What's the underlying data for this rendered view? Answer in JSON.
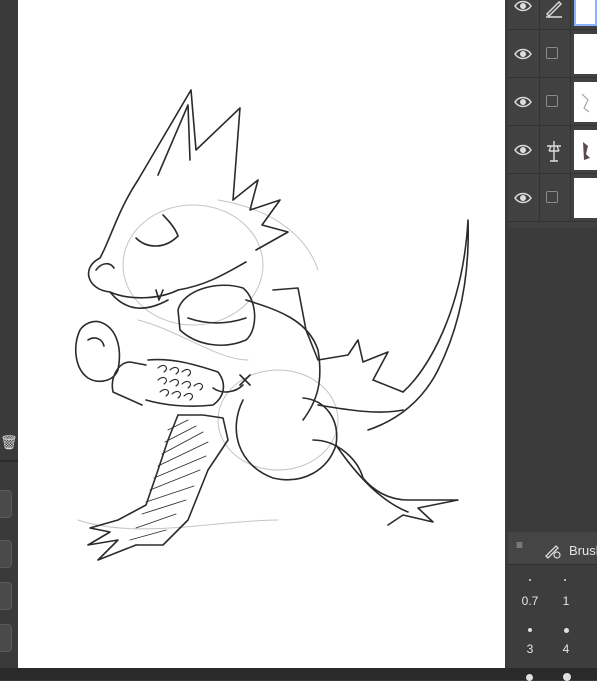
{
  "brush_panel": {
    "tab_label": "Brush",
    "menu_glyph": "≡",
    "brush_icon": "brush-icon",
    "sizes": [
      "0.7",
      "1",
      "3",
      "4"
    ]
  },
  "layers": [
    {
      "name": "active-layer",
      "visible": true,
      "icon": "pen-icon"
    },
    {
      "name": "layer-2",
      "visible": true,
      "icon": "checkbox"
    },
    {
      "name": "layer-3",
      "visible": true,
      "icon": "checkbox"
    },
    {
      "name": "layer-4",
      "visible": true,
      "icon": "reference-layer-icon"
    },
    {
      "name": "paper-layer",
      "visible": true,
      "icon": "checkbox"
    }
  ],
  "left_tools": {
    "trash_icon": "trash-icon"
  },
  "colors": {
    "panel": "#414141",
    "canvas": "#ffffff",
    "sketch_line": "#2b2b2b"
  }
}
